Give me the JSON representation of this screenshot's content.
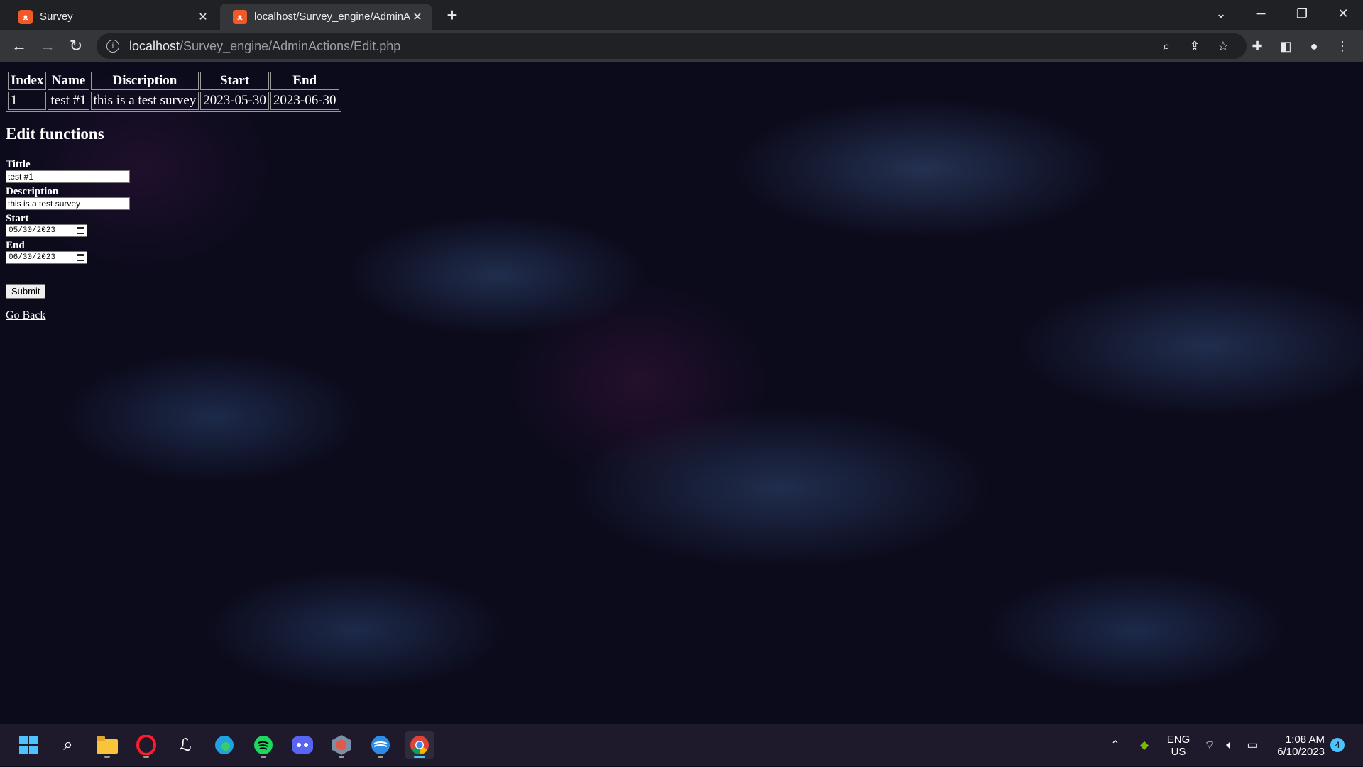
{
  "browser": {
    "tabs": [
      {
        "title": "Survey",
        "active": false
      },
      {
        "title": "localhost/Survey_engine/AdminA",
        "active": true
      }
    ],
    "url_host": "localhost",
    "url_path": "/Survey_engine/AdminActions/Edit.php"
  },
  "table": {
    "headers": [
      "Index",
      "Name",
      "Discription",
      "Start",
      "End"
    ],
    "rows": [
      [
        "1",
        "test #1",
        "this is a test survey",
        "2023-05-30",
        "2023-06-30"
      ]
    ]
  },
  "form": {
    "heading": "Edit functions",
    "title_label": "Tittle",
    "title_value": "test #1",
    "description_label": "Description",
    "description_value": "this is a test survey",
    "start_label": "Start",
    "start_value": "05/30/2023",
    "end_label": "End",
    "end_value": "06/30/2023",
    "submit_label": "Submit",
    "back_link": "Go Back"
  },
  "taskbar": {
    "apps": [
      "windows-start",
      "search",
      "file-explorer",
      "opera",
      "app",
      "edge",
      "spotify",
      "discord",
      "app",
      "app",
      "chrome"
    ],
    "language_top": "ENG",
    "language_bottom": "US",
    "time": "1:08 AM",
    "date": "6/10/2023",
    "notifications": "4"
  }
}
